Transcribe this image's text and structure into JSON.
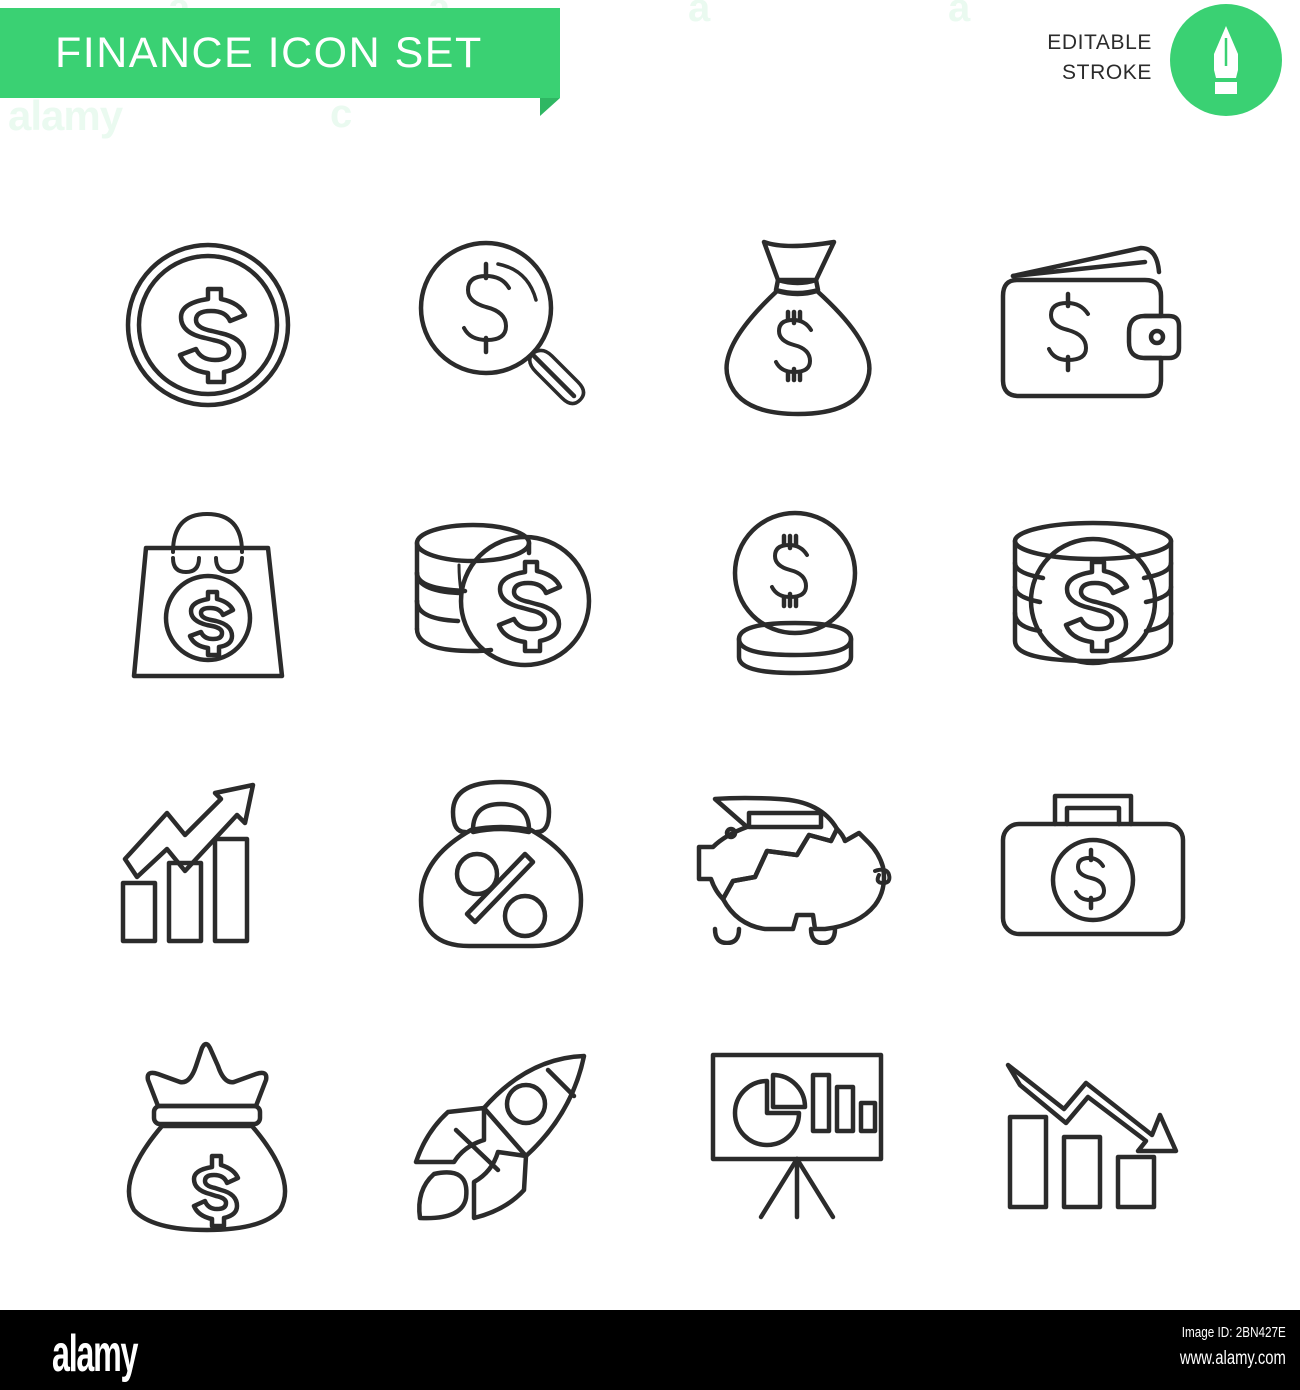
{
  "header": {
    "title": "FINANCE ICON SET",
    "badge_line1": "EDITABLE",
    "badge_line2": "STROKE",
    "badge_icon": "pen-nib-icon",
    "brand_color": "#3ad173",
    "stroke_color": "#2b2b2b",
    "background_color": "#ffffff"
  },
  "watermark": {
    "ghost_top": "alamy",
    "ghost_letter": "a",
    "ghost_letter_c": "c"
  },
  "grid": {
    "columns": 4,
    "rows": 4,
    "count": 16,
    "icons": [
      {
        "index": 1,
        "name": "dollar-coin-icon",
        "label": "Dollar coin"
      },
      {
        "index": 2,
        "name": "magnifier-dollar-icon",
        "label": "Search money"
      },
      {
        "index": 3,
        "name": "money-bag-icon",
        "label": "Money bag"
      },
      {
        "index": 4,
        "name": "wallet-dollar-icon",
        "label": "Wallet"
      },
      {
        "index": 5,
        "name": "shopping-bag-dollar-icon",
        "label": "Shopping bag"
      },
      {
        "index": 6,
        "name": "coin-stack-dollar-icon",
        "label": "Coin stack"
      },
      {
        "index": 7,
        "name": "coin-on-coins-icon",
        "label": "Coins"
      },
      {
        "index": 8,
        "name": "coin-roll-dollar-icon",
        "label": "Coin roll"
      },
      {
        "index": 9,
        "name": "growth-chart-arrow-up-icon",
        "label": "Profit growth"
      },
      {
        "index": 10,
        "name": "percent-weight-tag-icon",
        "label": "Discount"
      },
      {
        "index": 11,
        "name": "broken-piggy-bank-icon",
        "label": "Broken piggy bank"
      },
      {
        "index": 12,
        "name": "briefcase-dollar-icon",
        "label": "Business briefcase"
      },
      {
        "index": 13,
        "name": "money-sack-crown-icon",
        "label": "Money sack"
      },
      {
        "index": 14,
        "name": "rocket-icon",
        "label": "Startup rocket"
      },
      {
        "index": 15,
        "name": "presentation-board-chart-icon",
        "label": "Presentation"
      },
      {
        "index": 16,
        "name": "decline-chart-arrow-down-icon",
        "label": "Loss decline"
      }
    ]
  },
  "footer": {
    "logo": "alamy",
    "image_id": "Image ID: 2BN427E",
    "url": "www.alamy.com",
    "background_color": "#000000"
  }
}
